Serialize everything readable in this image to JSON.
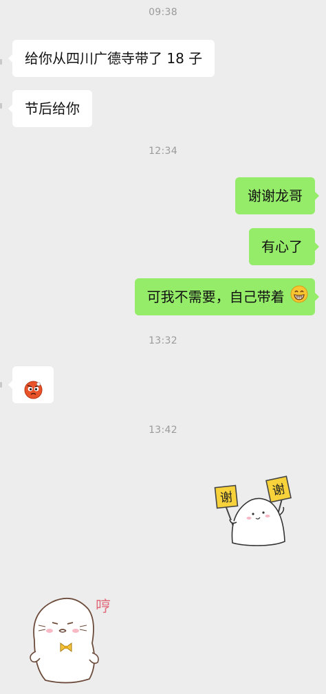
{
  "timestamps": [
    "09:38",
    "12:34",
    "13:32",
    "13:42"
  ],
  "messages": [
    {
      "side": "in",
      "text": "给你从四川广德寺带了 18 子"
    },
    {
      "side": "in",
      "text": "节后给你"
    },
    {
      "side": "out",
      "text": "谢谢龙哥"
    },
    {
      "side": "out",
      "text": "有心了"
    },
    {
      "side": "out",
      "text": "可我不需要，自己带着"
    }
  ],
  "emoji": {
    "grin": "grin-emoji",
    "angry": "angry-emoji"
  },
  "stickers": {
    "thanks": {
      "left_sign": "谢",
      "right_sign": "谢"
    },
    "hmph": {
      "text": "哼"
    }
  },
  "colors": {
    "background": "#ededed",
    "outgoing": "#95ec69",
    "incoming": "#ffffff"
  }
}
